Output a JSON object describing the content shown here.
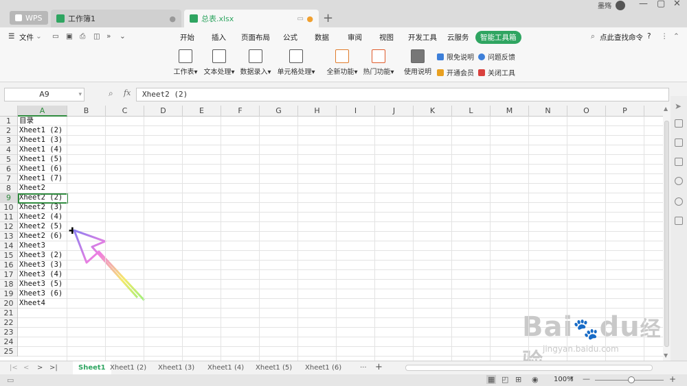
{
  "titlebar": {
    "tabs": [
      {
        "label": "WPS"
      },
      {
        "label": "工作簿1"
      },
      {
        "label": "总表.xlsx"
      }
    ],
    "new_tab": "+",
    "user_name": "墨殇"
  },
  "menu": {
    "file": "文件",
    "items": [
      "开始",
      "插入",
      "页面布局",
      "公式",
      "数据",
      "审阅",
      "视图",
      "开发工具",
      "云服务",
      "智能工具箱"
    ],
    "search": "点此查找命令",
    "help": "?"
  },
  "ribbon": {
    "big_buttons": [
      "工作表",
      "文本处理",
      "数据录入",
      "单元格处理",
      "全新功能",
      "热门功能",
      "使用说明"
    ],
    "small_buttons": [
      "限免说明",
      "问题反馈",
      "开通会员",
      "关闭工具"
    ]
  },
  "formula": {
    "name_box": "A9",
    "fx": "fx",
    "value": "Xheet2 (2)"
  },
  "columns": [
    "A",
    "B",
    "C",
    "D",
    "E",
    "F",
    "G",
    "H",
    "I",
    "J",
    "K",
    "L",
    "M",
    "N",
    "O",
    "P"
  ],
  "rows": [
    "1",
    "2",
    "3",
    "4",
    "5",
    "6",
    "7",
    "8",
    "9",
    "10",
    "11",
    "12",
    "13",
    "14",
    "15",
    "16",
    "17",
    "18",
    "19",
    "20",
    "21",
    "22",
    "23",
    "24",
    "25"
  ],
  "colA": [
    "目录",
    "Xheet1 (2)",
    "Xheet1 (3)",
    "Xheet1 (4)",
    "Xheet1 (5)",
    "Xheet1 (6)",
    "Xheet1 (7)",
    "Xheet2",
    "Xheet2 (2)",
    "Xheet2 (3)",
    "Xheet2 (4)",
    "Xheet2 (5)",
    "Xheet2 (6)",
    "Xheet3",
    "Xheet3 (2)",
    "Xheet3 (3)",
    "Xheet3 (4)",
    "Xheet3 (5)",
    "Xheet3 (6)",
    "Xheet4",
    "",
    "",
    "",
    "",
    ""
  ],
  "sheets": [
    "Sheet1",
    "Xheet1 (2)",
    "Xheet1 (3)",
    "Xheet1 (4)",
    "Xheet1 (5)",
    "Xheet1 (6)"
  ],
  "sheet_more": "···",
  "status": {
    "zoom": "100%"
  },
  "watermark": {
    "text1": "Bai",
    "text2": "du",
    "text3": "经验",
    "url": "jingyan.baidu.com"
  },
  "colors": {
    "accent": "#2fa561",
    "selection": "#2e8b3d"
  }
}
